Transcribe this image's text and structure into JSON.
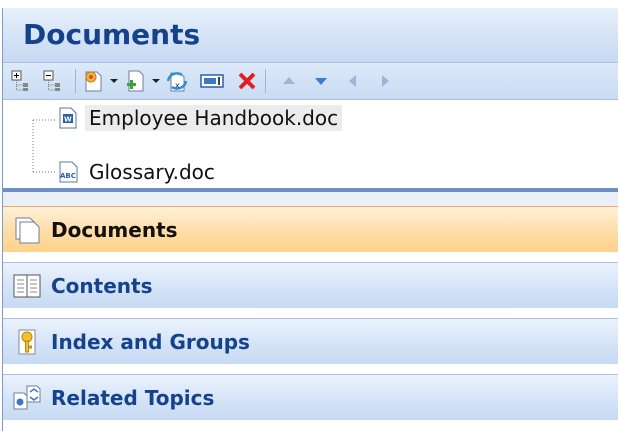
{
  "panel": {
    "title": "Documents"
  },
  "toolbar": {
    "buttons": [
      {
        "name": "expand-all-icon"
      },
      {
        "name": "collapse-all-icon"
      },
      {
        "name": "new-document-icon"
      },
      {
        "name": "add-document-icon"
      },
      {
        "name": "convert-document-icon"
      },
      {
        "name": "rename-icon"
      },
      {
        "name": "delete-icon"
      },
      {
        "name": "move-up-icon"
      },
      {
        "name": "move-down-icon"
      },
      {
        "name": "move-left-icon"
      },
      {
        "name": "move-right-icon"
      }
    ]
  },
  "tree": {
    "items": [
      {
        "label": "Employee Handbook.doc",
        "icon": "word-document-icon",
        "selected": true
      },
      {
        "label": "Glossary.doc",
        "icon": "abc-document-icon",
        "selected": false
      }
    ]
  },
  "nav": {
    "items": [
      {
        "label": "Documents",
        "icon": "documents-icon",
        "active": true
      },
      {
        "label": "Contents",
        "icon": "contents-book-icon",
        "active": false
      },
      {
        "label": "Index and Groups",
        "icon": "key-icon",
        "active": false
      },
      {
        "label": "Related Topics",
        "icon": "related-topics-icon",
        "active": false
      }
    ]
  },
  "colors": {
    "header_text": "#15428b",
    "active_nav": "#ffdba3",
    "delete_red": "#e02020"
  }
}
